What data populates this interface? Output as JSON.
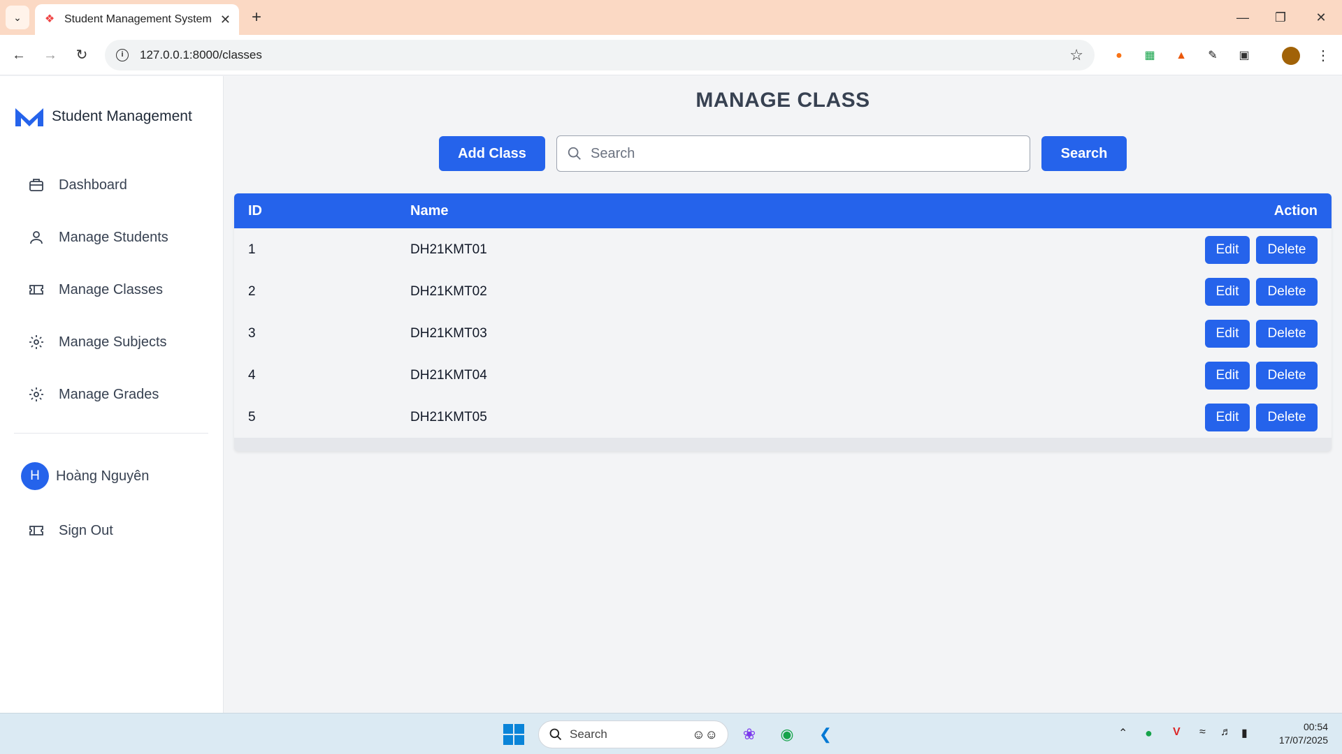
{
  "browser": {
    "tab_title": "Student Management System",
    "url": "127.0.0.1:8000/classes"
  },
  "sidebar": {
    "brand": "Student Management",
    "items": [
      {
        "label": "Dashboard",
        "icon": "briefcase-icon"
      },
      {
        "label": "Manage Students",
        "icon": "user-icon"
      },
      {
        "label": "Manage Classes",
        "icon": "ticket-icon"
      },
      {
        "label": "Manage Subjects",
        "icon": "gear-icon"
      },
      {
        "label": "Manage Grades",
        "icon": "gear-icon"
      }
    ],
    "user": {
      "initial": "H",
      "name": "Hoàng Nguyên"
    },
    "sign_out": "Sign Out"
  },
  "main": {
    "title": "MANAGE CLASS",
    "add_button": "Add Class",
    "search_placeholder": "Search",
    "search_button": "Search",
    "table": {
      "headers": [
        "ID",
        "Name",
        "Action"
      ],
      "rows": [
        {
          "id": "1",
          "name": "DH21KMT01"
        },
        {
          "id": "2",
          "name": "DH21KMT02"
        },
        {
          "id": "3",
          "name": "DH21KMT03"
        },
        {
          "id": "4",
          "name": "DH21KMT04"
        },
        {
          "id": "5",
          "name": "DH21KMT05"
        }
      ],
      "edit_label": "Edit",
      "delete_label": "Delete"
    }
  },
  "taskbar": {
    "search_label": "Search",
    "time": "00:54",
    "date": "17/07/2025"
  },
  "colors": {
    "primary": "#2563eb",
    "tab_strip": "#fbd9c4"
  }
}
